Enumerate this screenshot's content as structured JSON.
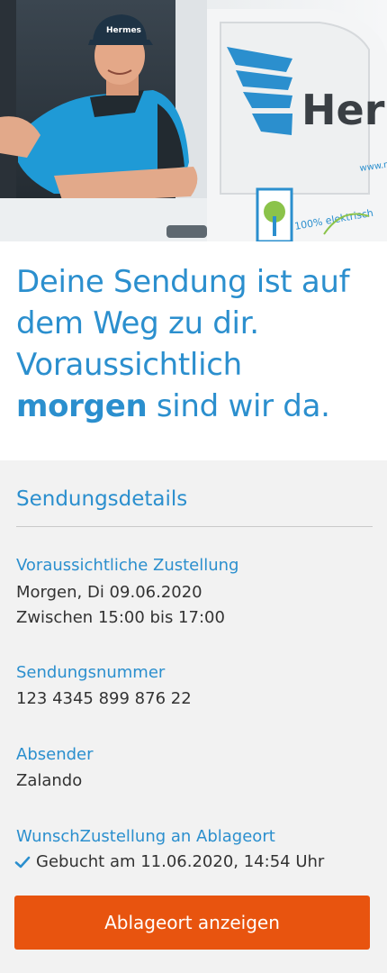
{
  "hero": {
    "van_brand": "Hermes",
    "cap_brand": "Hermes",
    "eco_text": "100% elektrisch"
  },
  "headline": {
    "text_before": "Deine Sendung ist auf dem Weg zu dir. Voraussichtlich ",
    "emphasis": "morgen",
    "text_after": " sind wir da."
  },
  "details": {
    "title": "Sendungsdetails",
    "delivery": {
      "label": "Voraussichtliche Zustellung",
      "date": "Morgen, Di 09.06.2020",
      "time": "Zwischen 15:00 bis 17:00"
    },
    "tracking": {
      "label": "Sendungsnummer",
      "value": "123 4345 899 876 22"
    },
    "sender": {
      "label": "Absender",
      "value": "Zalando"
    },
    "preference": {
      "label": "WunschZustellung an Ablageort",
      "value": "Gebucht am 11.06.2020, 14:54 Uhr",
      "icon": "check-icon"
    }
  },
  "cta": {
    "label": "Ablageort anzeigen"
  },
  "colors": {
    "accent_blue": "#2b8fce",
    "cta_orange": "#e8540f",
    "panel_grey": "#f2f2f2"
  }
}
